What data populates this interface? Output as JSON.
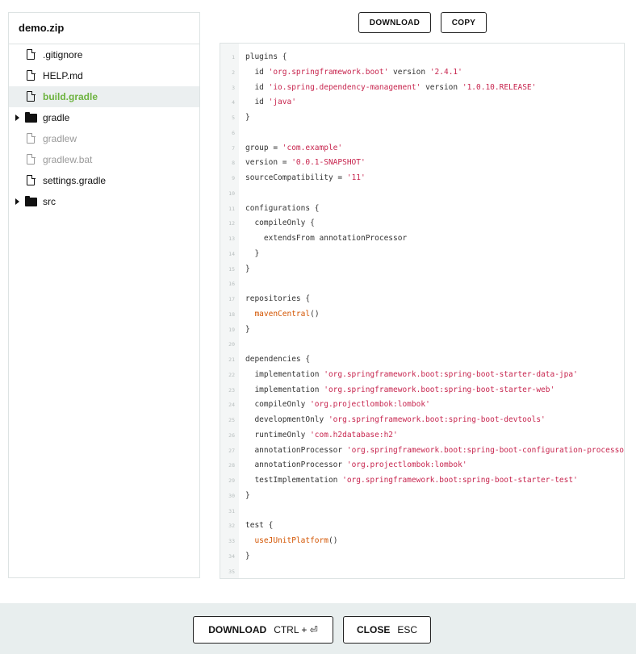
{
  "sidebar": {
    "title": "demo.zip",
    "items": [
      {
        "label": ".gitignore",
        "type": "file",
        "state": "normal"
      },
      {
        "label": "HELP.md",
        "type": "file",
        "state": "normal"
      },
      {
        "label": "build.gradle",
        "type": "file",
        "state": "selected"
      },
      {
        "label": "gradle",
        "type": "folder",
        "state": "normal"
      },
      {
        "label": "gradlew",
        "type": "file",
        "state": "muted"
      },
      {
        "label": "gradlew.bat",
        "type": "file",
        "state": "muted"
      },
      {
        "label": "settings.gradle",
        "type": "file",
        "state": "normal"
      },
      {
        "label": "src",
        "type": "folder",
        "state": "normal"
      }
    ]
  },
  "toolbar": {
    "download_label": "DOWNLOAD",
    "copy_label": "COPY"
  },
  "code": {
    "lines": [
      [
        [
          "t",
          "plugins {"
        ]
      ],
      [
        [
          "t",
          "  id "
        ],
        [
          "s",
          "'org.springframework.boot'"
        ],
        [
          "t",
          " version "
        ],
        [
          "s",
          "'2.4.1'"
        ]
      ],
      [
        [
          "t",
          "  id "
        ],
        [
          "s",
          "'io.spring.dependency-management'"
        ],
        [
          "t",
          " version "
        ],
        [
          "s",
          "'1.0.10.RELEASE'"
        ]
      ],
      [
        [
          "t",
          "  id "
        ],
        [
          "s",
          "'java'"
        ]
      ],
      [
        [
          "t",
          "}"
        ]
      ],
      [],
      [
        [
          "t",
          "group = "
        ],
        [
          "s",
          "'com.example'"
        ]
      ],
      [
        [
          "t",
          "version = "
        ],
        [
          "s",
          "'0.0.1-SNAPSHOT'"
        ]
      ],
      [
        [
          "t",
          "sourceCompatibility = "
        ],
        [
          "s",
          "'11'"
        ]
      ],
      [],
      [
        [
          "t",
          "configurations {"
        ]
      ],
      [
        [
          "t",
          "  compileOnly {"
        ]
      ],
      [
        [
          "t",
          "    extendsFrom annotationProcessor"
        ]
      ],
      [
        [
          "t",
          "  }"
        ]
      ],
      [
        [
          "t",
          "}"
        ]
      ],
      [],
      [
        [
          "t",
          "repositories {"
        ]
      ],
      [
        [
          "t",
          "  "
        ],
        [
          "f",
          "mavenCentral"
        ],
        [
          "t",
          "()"
        ]
      ],
      [
        [
          "t",
          "}"
        ]
      ],
      [],
      [
        [
          "t",
          "dependencies {"
        ]
      ],
      [
        [
          "t",
          "  implementation "
        ],
        [
          "s",
          "'org.springframework.boot:spring-boot-starter-data-jpa'"
        ]
      ],
      [
        [
          "t",
          "  implementation "
        ],
        [
          "s",
          "'org.springframework.boot:spring-boot-starter-web'"
        ]
      ],
      [
        [
          "t",
          "  compileOnly "
        ],
        [
          "s",
          "'org.projectlombok:lombok'"
        ]
      ],
      [
        [
          "t",
          "  developmentOnly "
        ],
        [
          "s",
          "'org.springframework.boot:spring-boot-devtools'"
        ]
      ],
      [
        [
          "t",
          "  runtimeOnly "
        ],
        [
          "s",
          "'com.h2database:h2'"
        ]
      ],
      [
        [
          "t",
          "  annotationProcessor "
        ],
        [
          "s",
          "'org.springframework.boot:spring-boot-configuration-processor'"
        ]
      ],
      [
        [
          "t",
          "  annotationProcessor "
        ],
        [
          "s",
          "'org.projectlombok:lombok'"
        ]
      ],
      [
        [
          "t",
          "  testImplementation "
        ],
        [
          "s",
          "'org.springframework.boot:spring-boot-starter-test'"
        ]
      ],
      [
        [
          "t",
          "}"
        ]
      ],
      [],
      [
        [
          "t",
          "test {"
        ]
      ],
      [
        [
          "t",
          "  "
        ],
        [
          "f",
          "useJUnitPlatform"
        ],
        [
          "t",
          "()"
        ]
      ],
      [
        [
          "t",
          "}"
        ]
      ],
      []
    ]
  },
  "footer": {
    "download_label": "DOWNLOAD",
    "download_shortcut": "CTRL + ⏎",
    "close_label": "CLOSE",
    "close_shortcut": "ESC"
  },
  "colors": {
    "accent_green": "#6db33f",
    "string": "#c7254e",
    "function": "#d35400",
    "footer_bg": "#e8eeee"
  }
}
